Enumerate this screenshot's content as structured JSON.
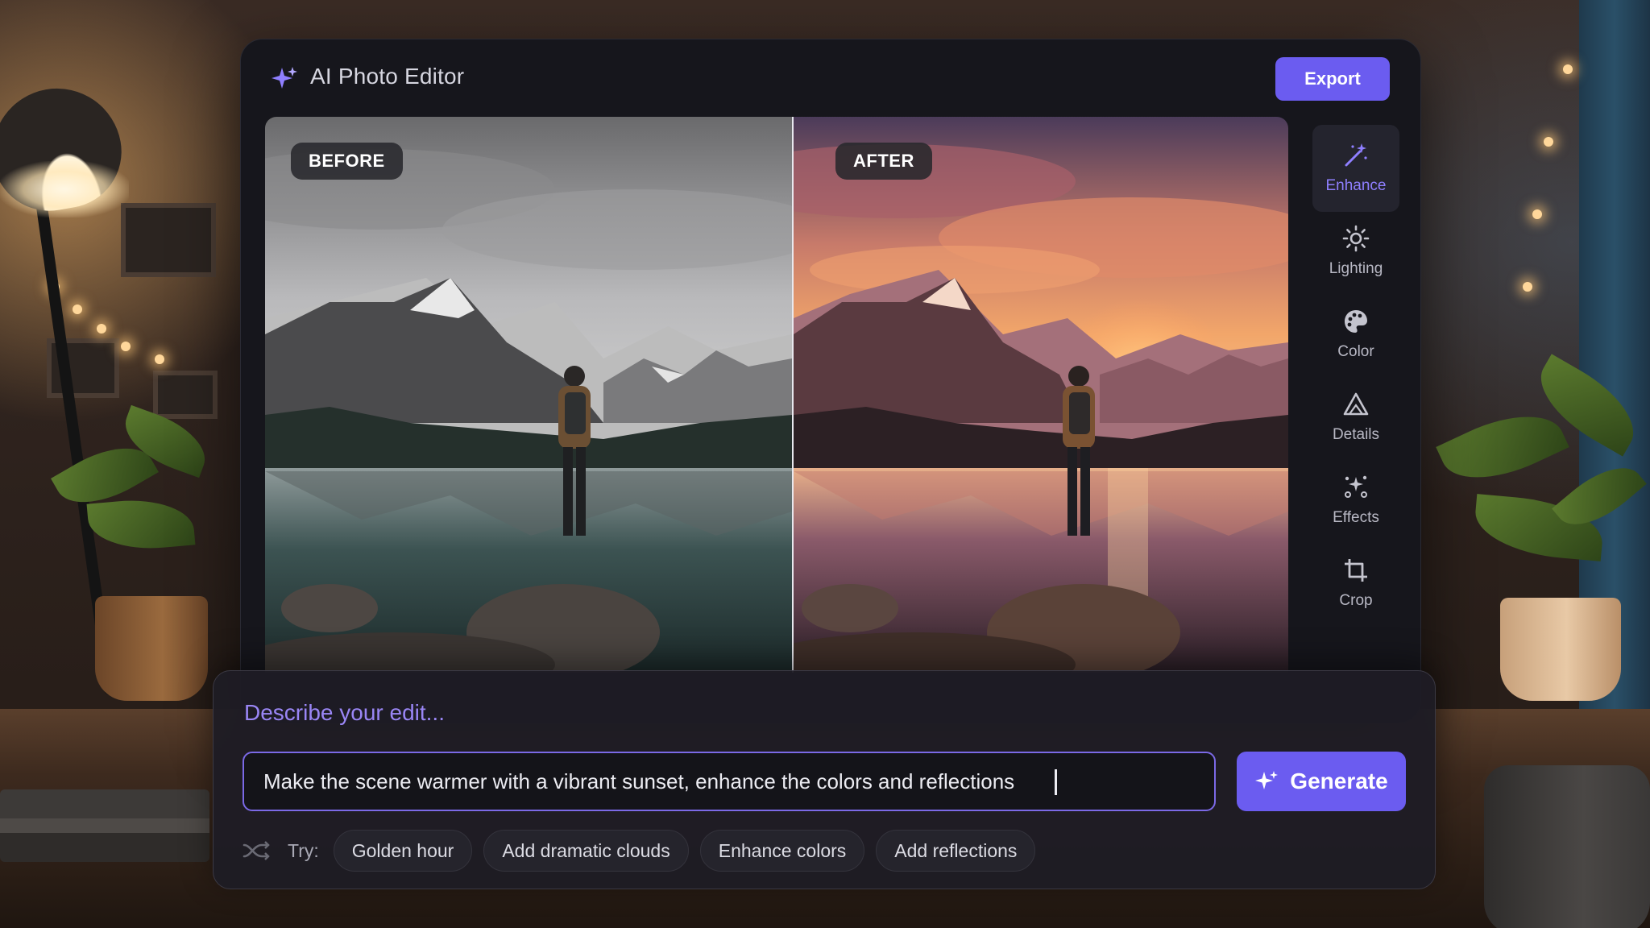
{
  "app": {
    "title": "AI Photo Editor",
    "export_label": "Export",
    "accent_color": "#6b5cf0"
  },
  "canvas": {
    "before_label": "BEFORE",
    "after_label": "AFTER"
  },
  "tools": {
    "active": "Enhance",
    "items": [
      {
        "label": "Enhance",
        "icon": "magic-wand-icon"
      },
      {
        "label": "Lighting",
        "icon": "sun-icon"
      },
      {
        "label": "Color",
        "icon": "palette-icon"
      },
      {
        "label": "Details",
        "icon": "triangle-icon"
      },
      {
        "label": "Effects",
        "icon": "sparkles-icon"
      },
      {
        "label": "Crop",
        "icon": "crop-icon"
      }
    ]
  },
  "prompt": {
    "heading": "Describe your edit...",
    "input_value": "Make the scene warmer with a vibrant sunset, enhance the colors and reflections",
    "generate_label": "Generate",
    "try_label": "Try:",
    "suggestions": [
      "Golden hour",
      "Add dramatic clouds",
      "Enhance colors",
      "Add reflections"
    ]
  }
}
